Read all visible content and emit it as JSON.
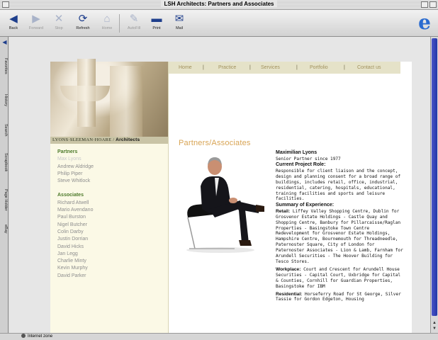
{
  "window": {
    "title": "LSH Architects: Partners and Associates"
  },
  "toolbar": {
    "buttons": [
      {
        "label": "Back",
        "icon": "back-arrow-icon"
      },
      {
        "label": "Forward",
        "icon": "forward-arrow-icon"
      },
      {
        "label": "Stop",
        "icon": "stop-icon"
      },
      {
        "label": "Refresh",
        "icon": "refresh-icon"
      },
      {
        "label": "Home",
        "icon": "home-icon"
      },
      {
        "label": "AutoFill",
        "icon": "autofill-icon"
      },
      {
        "label": "Print",
        "icon": "print-icon"
      },
      {
        "label": "Mail",
        "icon": "mail-icon"
      }
    ]
  },
  "explorer": {
    "tabs": [
      "Favorites",
      "History",
      "Search",
      "Scrapbook",
      "Page Holder",
      "eBay"
    ]
  },
  "status": {
    "text": "Internet zone"
  },
  "site": {
    "brand_text": "LYONS·SLEEMAN·HOARE /",
    "brand_bold": "Architects",
    "nav": [
      "Home",
      "Practice",
      "Services",
      "Portfolio",
      "Contact us"
    ],
    "nav_sep": "|",
    "heading": "Partners/Associates",
    "partners_label": "Partners",
    "partners": [
      "Max Lyons",
      "Andrew Aldridge",
      "Philip Piper",
      "Steve Whitlock"
    ],
    "associates_label": "Associates",
    "associates": [
      "Richard Atwell",
      "Mario Avendano",
      "Paul Burston",
      "Nigel Butcher",
      "Colin Darby",
      "Justin Dorrian",
      "David Hicks",
      "Jan Legg",
      "Charlie Minty",
      "Kevin Murphy",
      "David Parker"
    ]
  },
  "bio": {
    "name": "Maximilian Lyons",
    "title": "Senior Partner since 1977",
    "role_heading": "Current Project Role:",
    "role_text": "Responsible for client liaison and the concept, design and planning consent for a broad range of buildings, includes retail, office, industrial, residential, catering, hospitals, educational, training facilities and sports and leisure facilities.",
    "summary_heading": "Summary of Experience:",
    "retail_label": "Retail:",
    "retail_text": "Liffey Valley Shopping Centre, Dublin for Grosvenor Estate Holdings - Castle Quay and Shopping Centre, Banbury for Pillarcaisse/Raglan Properties - Basingstoke Town Centre Redevelopment for Grosvenor Estate Holdings, Hampshire Centre, Bournemouth for Threadneedle, Paternoster Square, City of London for Paternoster Associates - Lion & Lamb, Farnham for Arundell Securities - The Hoover Building for Tesco Stores.",
    "workplace_label": "Workplace:",
    "workplace_text": "Court and Crescent for Arundell House Securities - Capital Court, Uxbridge for Capital & Counties, Cornhill for Guardian Properties, Basingstoke for IBM",
    "residential_label": "Residential:",
    "residential_text": "Horseferry Road for St George, Silver Tassie for Gordon Edgeton, Housing"
  }
}
